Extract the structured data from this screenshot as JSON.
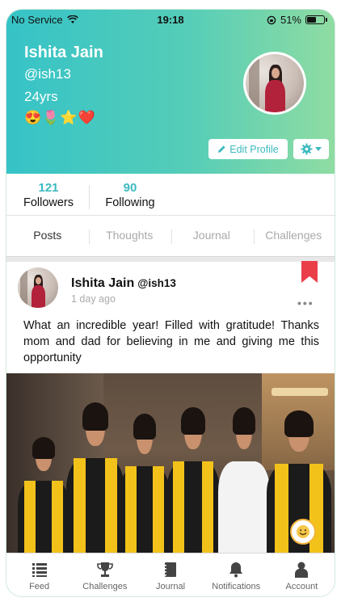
{
  "status_bar": {
    "carrier": "No Service",
    "time": "19:18",
    "battery": "51%",
    "battery_level": 0.51
  },
  "profile": {
    "name": "Ishita Jain",
    "handle": "@ish13",
    "age": "24yrs",
    "emojis": "😍🌷⭐❤️",
    "edit_label": "Edit Profile"
  },
  "stats": {
    "followers_count": "121",
    "followers_label": "Followers",
    "following_count": "90",
    "following_label": "Following"
  },
  "tabs": [
    {
      "label": "Posts",
      "active": true
    },
    {
      "label": "Thoughts",
      "active": false
    },
    {
      "label": "Journal",
      "active": false
    },
    {
      "label": "Challenges",
      "active": false
    }
  ],
  "post": {
    "author": "Ishita Jain",
    "handle": "@ish13",
    "time": "1 day ago",
    "text": "What an incredible year! Filled with gratitude! Thanks mom and dad for believing in me and giving me this opportunity"
  },
  "bottom_nav": [
    {
      "label": "Feed",
      "icon": "list-icon"
    },
    {
      "label": "Challenges",
      "icon": "trophy-icon"
    },
    {
      "label": "Journal",
      "icon": "notebook-icon"
    },
    {
      "label": "Notifications",
      "icon": "bell-icon"
    },
    {
      "label": "Account",
      "icon": "person-icon"
    }
  ],
  "colors": {
    "accent": "#3bb9bf",
    "header_start": "#36c3c7",
    "header_end": "#8fdca2",
    "bookmark": "#ea3f48"
  }
}
